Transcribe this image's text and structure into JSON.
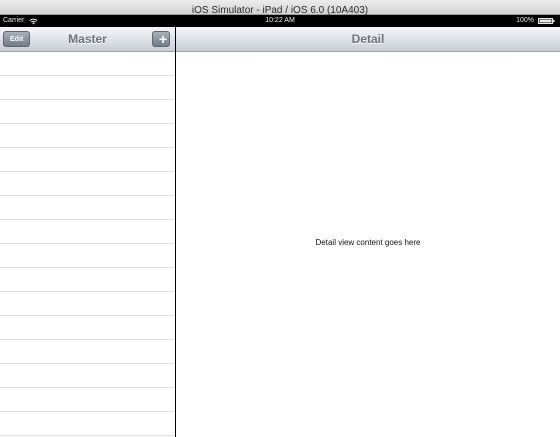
{
  "window": {
    "title": "iOS Simulator - iPad / iOS 6.0 (10A403)"
  },
  "status_bar": {
    "carrier": "Carrier",
    "time": "10:22 AM",
    "battery": "100%",
    "wifi_icon": "wifi-icon",
    "battery_icon": "battery-icon"
  },
  "master": {
    "title": "Master",
    "edit_label": "Edit",
    "add_label": "+",
    "rows": [
      "",
      "",
      "",
      "",
      "",
      "",
      "",
      "",
      "",
      "",
      "",
      "",
      "",
      "",
      "",
      ""
    ]
  },
  "detail": {
    "title": "Detail",
    "content": "Detail view content goes here"
  }
}
